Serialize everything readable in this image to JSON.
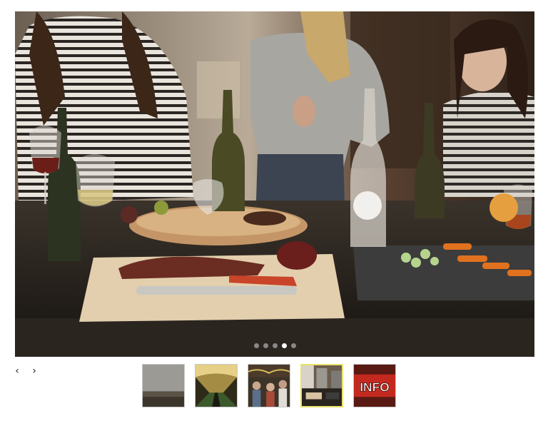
{
  "slider": {
    "slide_count": 5,
    "active_index": 3,
    "accent_color": "#e9e36b"
  },
  "controls": {
    "prev_glyph": "‹",
    "next_glyph": "›",
    "prev_icon": "chevron-left-icon",
    "next_icon": "chevron-right-icon"
  },
  "thumbnails": [
    {
      "id": "thumb-1",
      "subject": "cloudy-landscape"
    },
    {
      "id": "thumb-2",
      "subject": "tunnel-escalator"
    },
    {
      "id": "thumb-3",
      "subject": "festive-crowd"
    },
    {
      "id": "thumb-4",
      "subject": "wine-party",
      "active": true
    },
    {
      "id": "thumb-5",
      "subject": "info-sign",
      "text": "INFO"
    }
  ]
}
